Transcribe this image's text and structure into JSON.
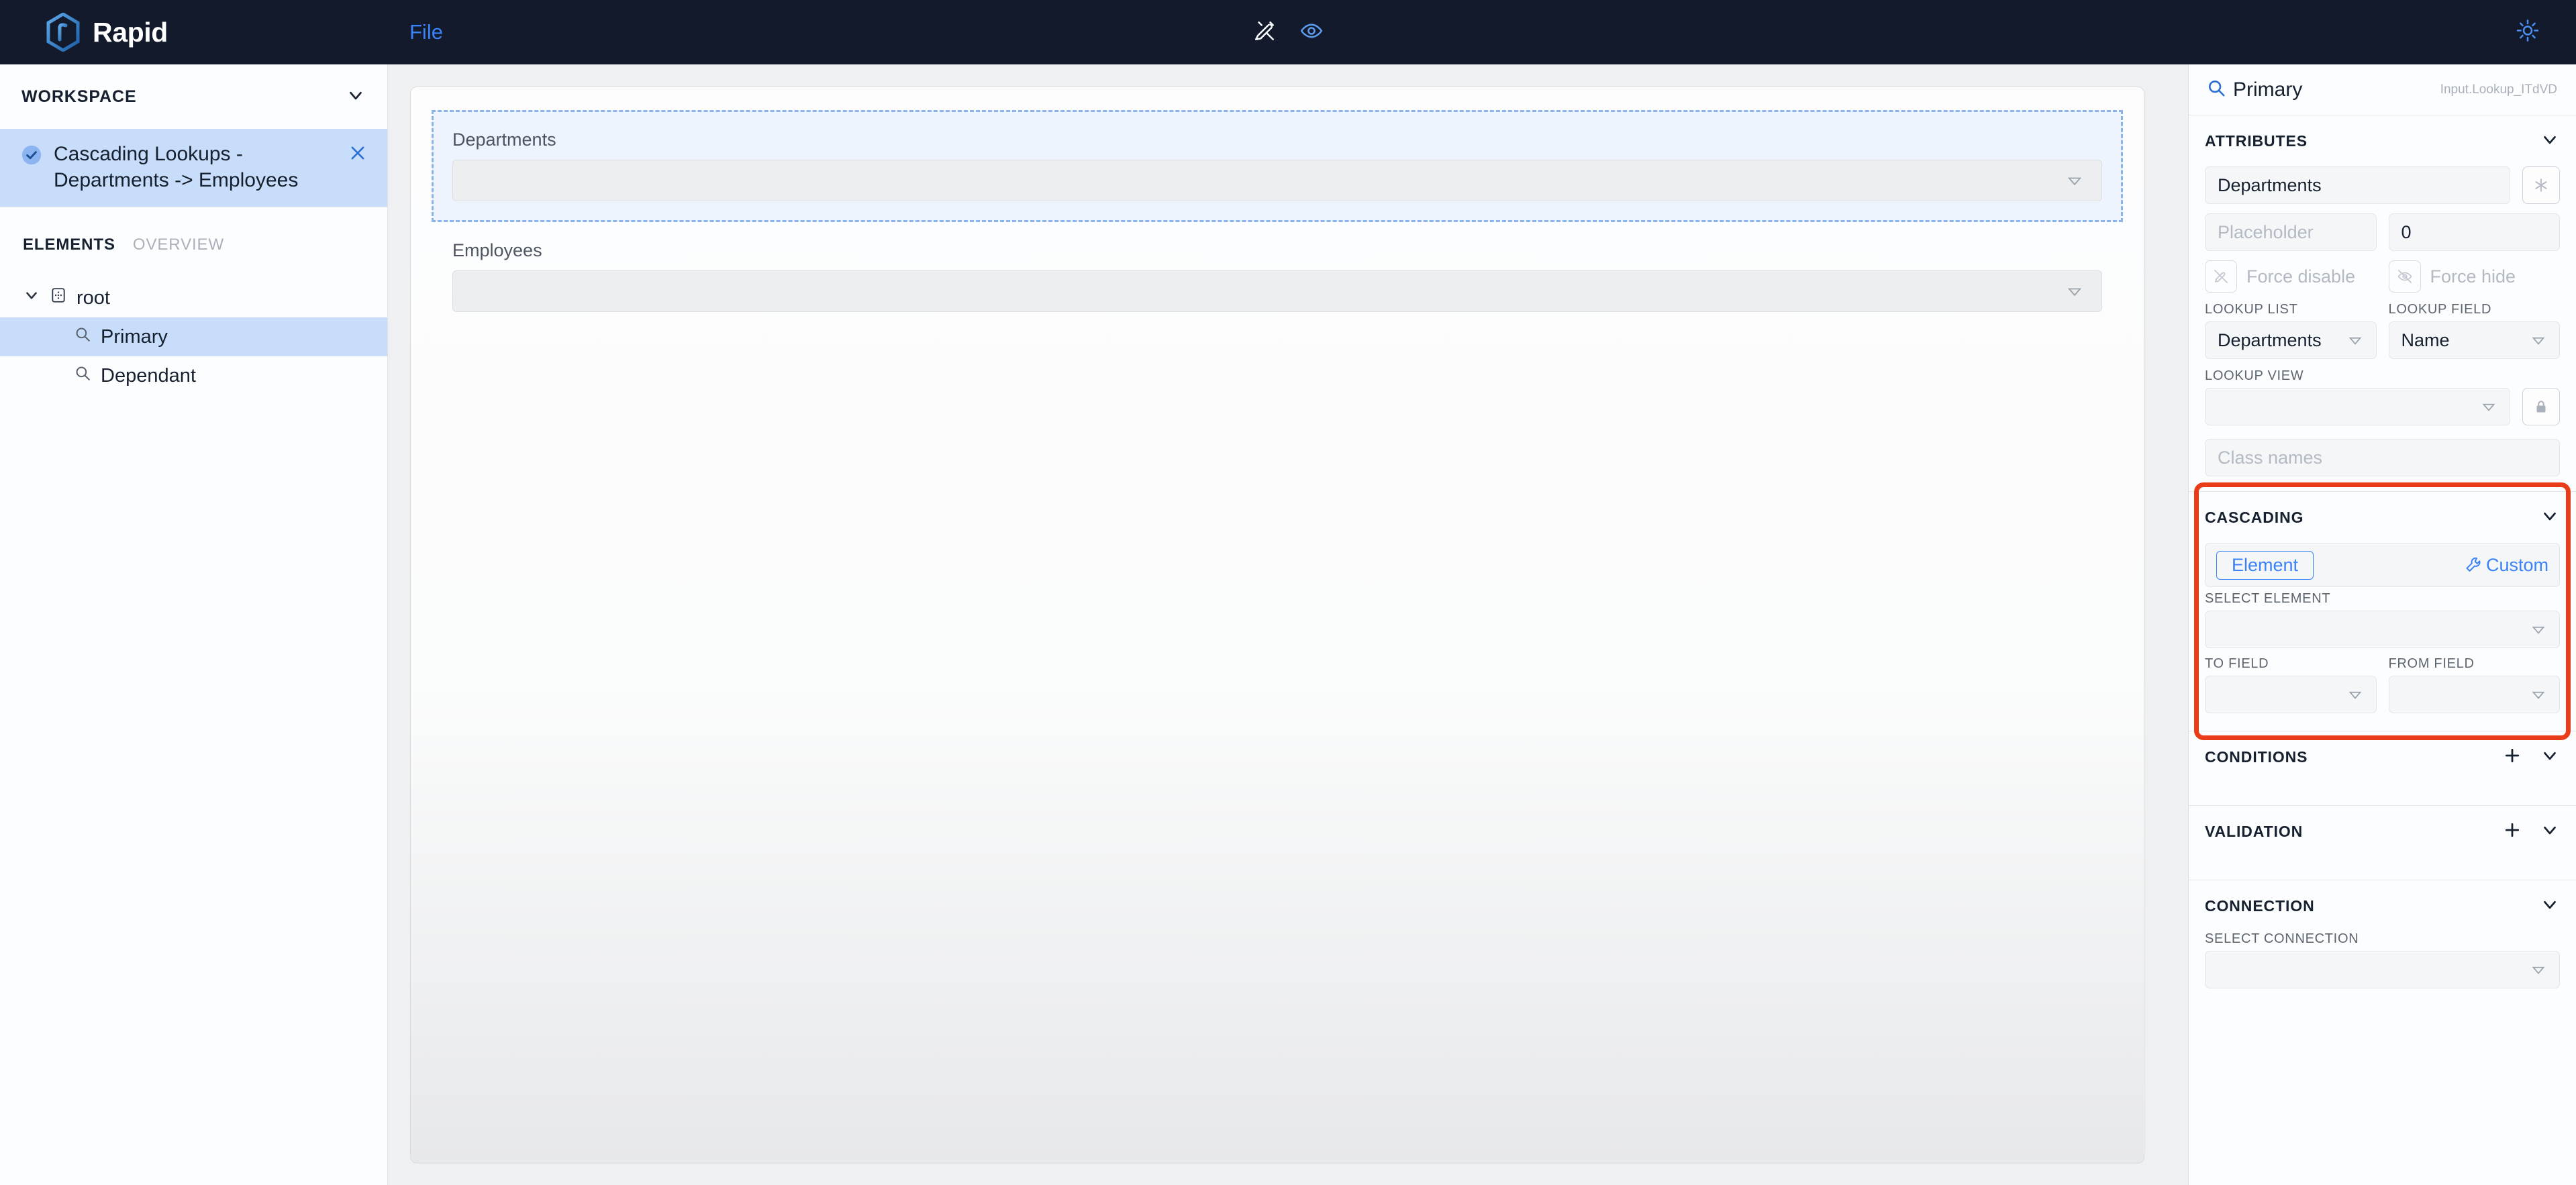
{
  "brand": {
    "name": "Rapid"
  },
  "topbar": {
    "file_menu": "File",
    "design_icon": "pencil-design-icon",
    "preview_icon": "eye-icon",
    "theme_icon": "sun-icon"
  },
  "sidebar": {
    "workspace_label": "WORKSPACE",
    "workspace_item": {
      "label": "Cascading Lookups - Departments -> Employees",
      "check_icon": "check-circle-icon",
      "close_icon": "close-icon"
    },
    "tabs": [
      {
        "label": "ELEMENTS",
        "active": true
      },
      {
        "label": "OVERVIEW",
        "active": false
      }
    ],
    "tree": [
      {
        "label": "root",
        "icon": "grid-dots-icon",
        "depth": 0,
        "selected": false,
        "expanded": true
      },
      {
        "label": "Primary",
        "icon": "search-icon",
        "depth": 1,
        "selected": true
      },
      {
        "label": "Dependant",
        "icon": "search-icon",
        "depth": 1,
        "selected": false
      }
    ]
  },
  "canvas": {
    "fields": [
      {
        "label": "Departments",
        "value": "",
        "selected": true
      },
      {
        "label": "Employees",
        "value": "",
        "selected": false
      }
    ]
  },
  "properties": {
    "header": {
      "icon": "search-icon",
      "title": "Primary",
      "id": "Input.Lookup_ITdVD"
    },
    "attributes": {
      "title": "ATTRIBUTES",
      "collapse_icon": "chevron-down-icon",
      "name_value": "Departments",
      "required_icon": "asterisk-icon",
      "placeholder_placeholder": "Placeholder",
      "placeholder_value": "",
      "order_value": "0",
      "force_disable_label": "Force disable",
      "force_disable_icon": "pen-off-icon",
      "force_hide_label": "Force hide",
      "force_hide_icon": "eye-off-icon",
      "lookup_list_label": "LOOKUP LIST",
      "lookup_list_value": "Departments",
      "lookup_field_label": "LOOKUP FIELD",
      "lookup_field_value": "Name",
      "lookup_view_label": "LOOKUP VIEW",
      "lookup_view_value": "",
      "lock_icon": "lock-icon",
      "class_names_placeholder": "Class names",
      "class_names_value": ""
    },
    "cascading": {
      "title": "CASCADING",
      "collapse_icon": "chevron-down-icon",
      "mode_element": "Element",
      "mode_custom": "Custom",
      "custom_icon": "wrench-icon",
      "select_element_label": "SELECT ELEMENT",
      "select_element_value": "",
      "to_field_label": "TO FIELD",
      "to_field_value": "",
      "from_field_label": "FROM FIELD",
      "from_field_value": "",
      "highlight_color": "#ea3c18"
    },
    "conditions": {
      "title": "CONDITIONS",
      "add_icon": "plus-icon",
      "collapse_icon": "chevron-down-icon"
    },
    "validation": {
      "title": "VALIDATION",
      "add_icon": "plus-icon",
      "collapse_icon": "chevron-down-icon"
    },
    "connection": {
      "title": "CONNECTION",
      "collapse_icon": "chevron-down-icon",
      "select_connection_label": "SELECT CONNECTION",
      "select_connection_value": ""
    }
  },
  "colors": {
    "topbar_bg": "#121a2b",
    "accent_blue": "#3b82f6",
    "selection_blue": "#c7ddfa",
    "highlight_red": "#ea3c18"
  }
}
